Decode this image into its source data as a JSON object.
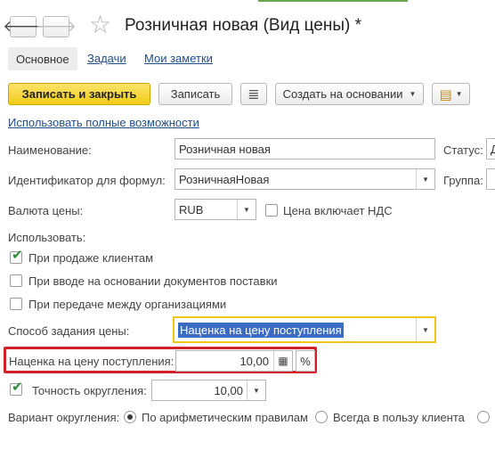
{
  "window": {
    "title": "Розничная новая (Вид цены) *",
    "back_glyph": "🡐",
    "forward_glyph": "🡒",
    "star_glyph": "☆"
  },
  "tabs": {
    "main": "Основное",
    "tasks": "Задачи",
    "notes": "Мои заметки"
  },
  "toolbar": {
    "save_close": "Записать и закрыть",
    "save": "Записать",
    "create_based": "Создать на основании",
    "list_icon": "≣",
    "report_icon": "▤"
  },
  "full_features_link": "Использовать полные возможности",
  "form": {
    "name_label": "Наименование:",
    "name_value": "Розничная новая",
    "status_label": "Статус:",
    "status_value": "Д",
    "formula_id_label": "Идентификатор для формул:",
    "formula_id_value": "РозничнаяНовая",
    "group_label": "Группа:",
    "currency_label": "Валюта цены:",
    "currency_value": "RUB",
    "vat_label": "Цена включает НДС",
    "vat_checked": false,
    "use_label": "Использовать:",
    "use_options": [
      {
        "label": "При продаже клиентам",
        "checked": true
      },
      {
        "label": "При вводе на основании документов поставки",
        "checked": false
      },
      {
        "label": "При передаче между организациями",
        "checked": false
      }
    ],
    "method_label": "Способ задания цены:",
    "method_value": "Наценка на цену поступления",
    "markup_label": "Наценка на цену поступления:",
    "markup_value": "10,00",
    "markup_unit": "%",
    "rounding_label": "Точность округления:",
    "rounding_checked": true,
    "rounding_value": "10,00",
    "variant_label": "Вариант округления:",
    "variant_options": [
      {
        "label": "По арифметическим правилам",
        "selected": true
      },
      {
        "label": "Всегда в пользу клиента",
        "selected": false
      }
    ]
  },
  "colors": {
    "primary_button": "#f1cc18",
    "link": "#1f4e8c",
    "highlight_box": "#d3202a",
    "focus_border": "#f0c419",
    "selection": "#3b6cc4",
    "checkmark": "#2e8b3a"
  }
}
